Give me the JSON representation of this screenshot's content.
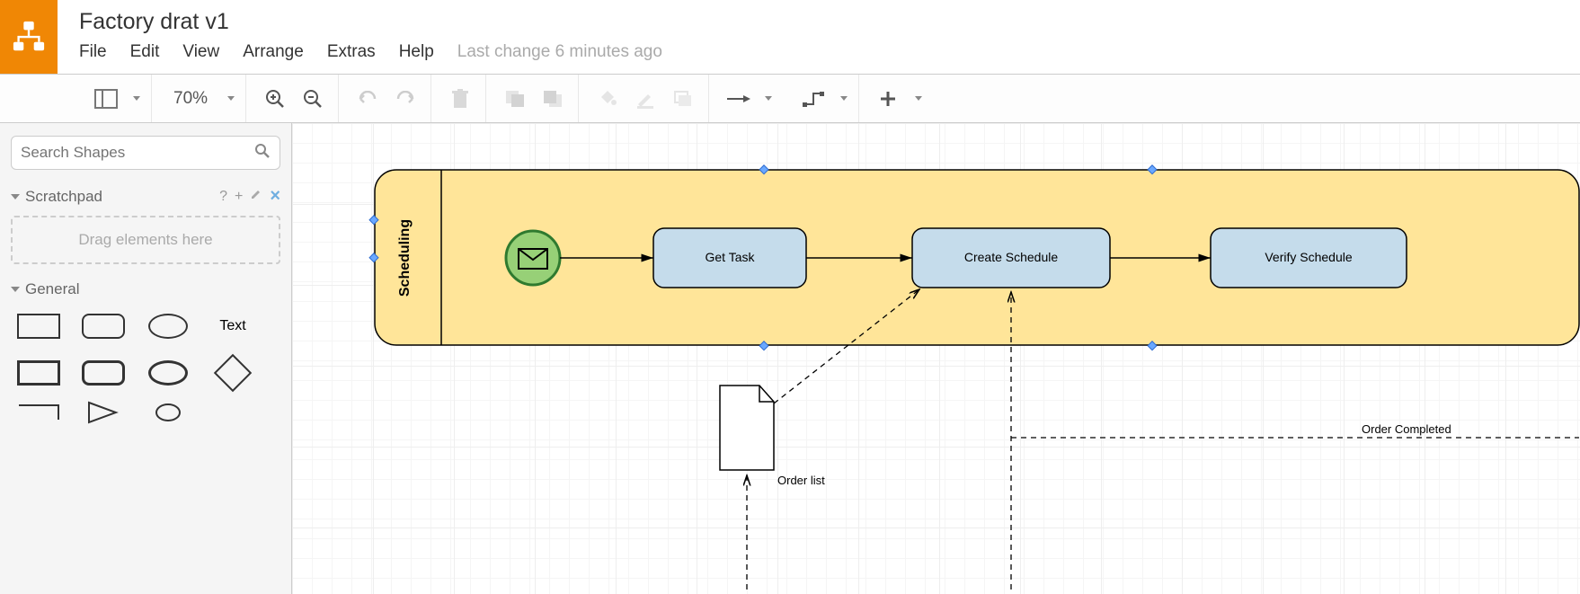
{
  "title": "Factory drat v1",
  "menu": {
    "items": [
      "File",
      "Edit",
      "View",
      "Arrange",
      "Extras",
      "Help"
    ]
  },
  "status": "Last change 6 minutes ago",
  "toolbar": {
    "zoom": "70%"
  },
  "sidebar": {
    "search_placeholder": "Search Shapes",
    "scratchpad_label": "Scratchpad",
    "scratchpad_help": "?",
    "scratchpad_hint": "Drag elements here",
    "general_label": "General",
    "text_shape": "Text"
  },
  "diagram": {
    "lane_label": "Scheduling",
    "tasks": {
      "get_task": "Get Task",
      "create_schedule": "Create Schedule",
      "verify_schedule": "Verify Schedule"
    },
    "data_obj": "Order list",
    "annotation": "Order Completed"
  },
  "colors": {
    "lane_fill": "#ffe599",
    "task_fill": "#c5dceb",
    "task_stroke": "#000",
    "start_fill": "#97d077",
    "start_stroke": "#2f7a2f"
  }
}
